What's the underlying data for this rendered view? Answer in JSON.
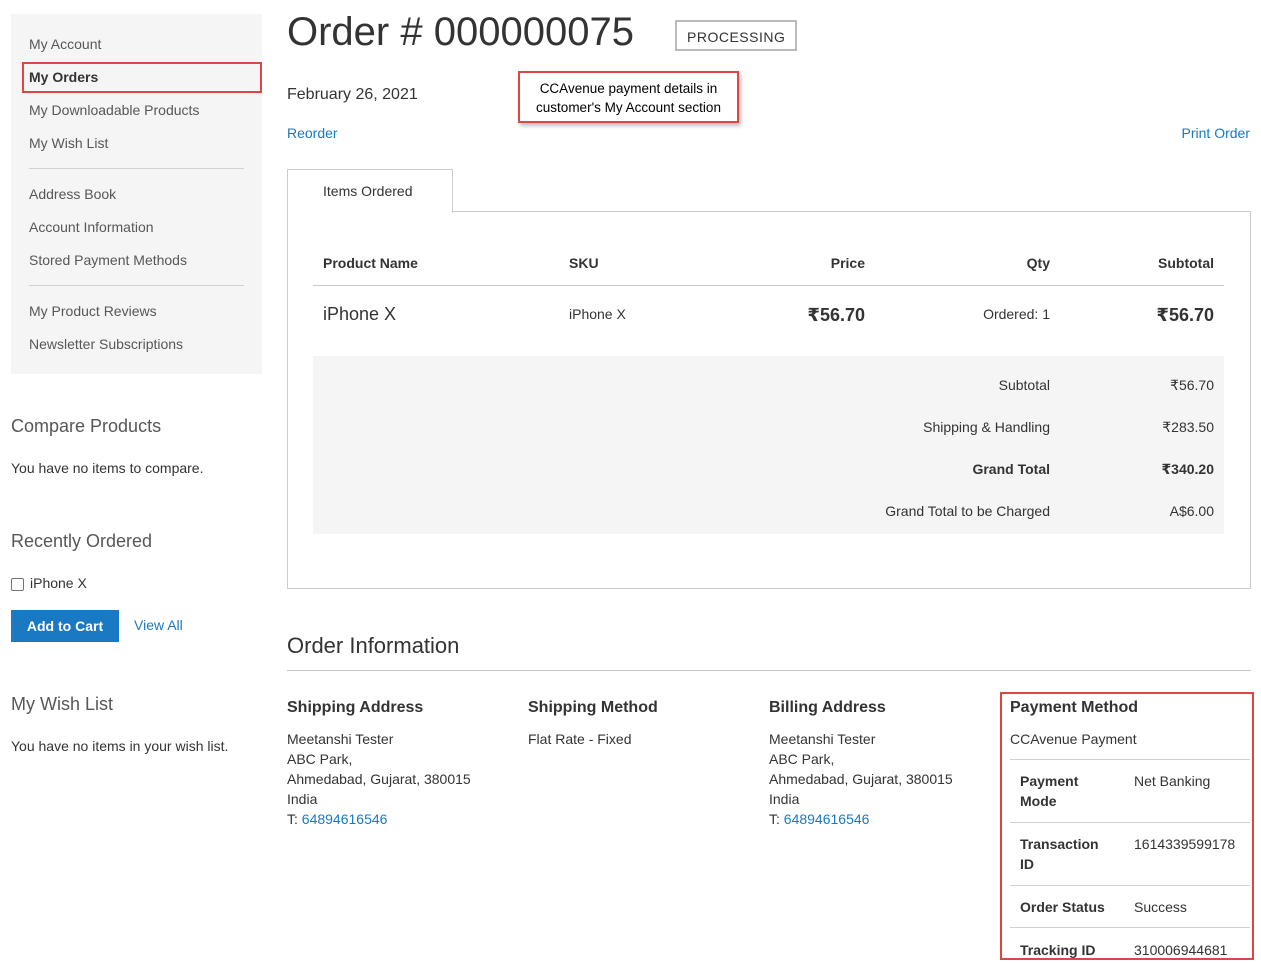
{
  "nav": {
    "items": [
      {
        "label": "My Account"
      },
      {
        "label": "My Orders"
      },
      {
        "label": "My Downloadable Products"
      },
      {
        "label": "My Wish List"
      },
      {
        "label": "Address Book"
      },
      {
        "label": "Account Information"
      },
      {
        "label": "Stored Payment Methods"
      },
      {
        "label": "My Product Reviews"
      },
      {
        "label": "Newsletter Subscriptions"
      }
    ]
  },
  "compare": {
    "title": "Compare Products",
    "empty": "You have no items to compare."
  },
  "recent": {
    "title": "Recently Ordered",
    "item": "iPhone X",
    "add_to_cart": "Add to Cart",
    "view_all": "View All"
  },
  "wishlist": {
    "title": "My Wish List",
    "empty": "You have no items in your wish list."
  },
  "order": {
    "title": "Order # 000000075",
    "status": "PROCESSING",
    "date": "February 26, 2021",
    "reorder": "Reorder",
    "print": "Print Order"
  },
  "callout": {
    "line1": "CCAvenue payment details in",
    "line2": "customer's My Account section"
  },
  "items": {
    "tab": "Items Ordered",
    "headers": {
      "product": "Product Name",
      "sku": "SKU",
      "price": "Price",
      "qty": "Qty",
      "subtotal": "Subtotal"
    },
    "row": {
      "product": "iPhone X",
      "sku": "iPhone X",
      "price": "₹56.70",
      "qty": "Ordered: 1",
      "subtotal": "₹56.70"
    },
    "totals": [
      {
        "label": "Subtotal",
        "value": "₹56.70"
      },
      {
        "label": "Shipping & Handling",
        "value": "₹283.50"
      },
      {
        "label": "Grand Total",
        "value": "₹340.20"
      },
      {
        "label": "Grand Total to be Charged",
        "value": "A$6.00"
      }
    ]
  },
  "info": {
    "title": "Order Information",
    "shipping_address": {
      "title": "Shipping Address",
      "name": "Meetanshi Tester",
      "street": "ABC Park,",
      "city": "Ahmedabad, Gujarat, 380015",
      "country": "India",
      "phone_prefix": "T: ",
      "phone": "64894616546"
    },
    "shipping_method": {
      "title": "Shipping Method",
      "value": "Flat Rate - Fixed"
    },
    "billing_address": {
      "title": "Billing Address",
      "name": "Meetanshi Tester",
      "street": "ABC Park,",
      "city": "Ahmedabad, Gujarat, 380015",
      "country": "India",
      "phone_prefix": "T: ",
      "phone": "64894616546"
    },
    "payment": {
      "title": "Payment Method",
      "method": "CCAvenue Payment",
      "rows": [
        {
          "label1": "Payment",
          "label2": "Mode",
          "value": "Net Banking"
        },
        {
          "label1": "Transaction",
          "label2": "ID",
          "value": "1614339599178"
        },
        {
          "label1": "Order Status",
          "label2": "",
          "value": "Success"
        },
        {
          "label1": "Tracking ID",
          "label2": "",
          "value": "310006944681"
        }
      ]
    }
  }
}
